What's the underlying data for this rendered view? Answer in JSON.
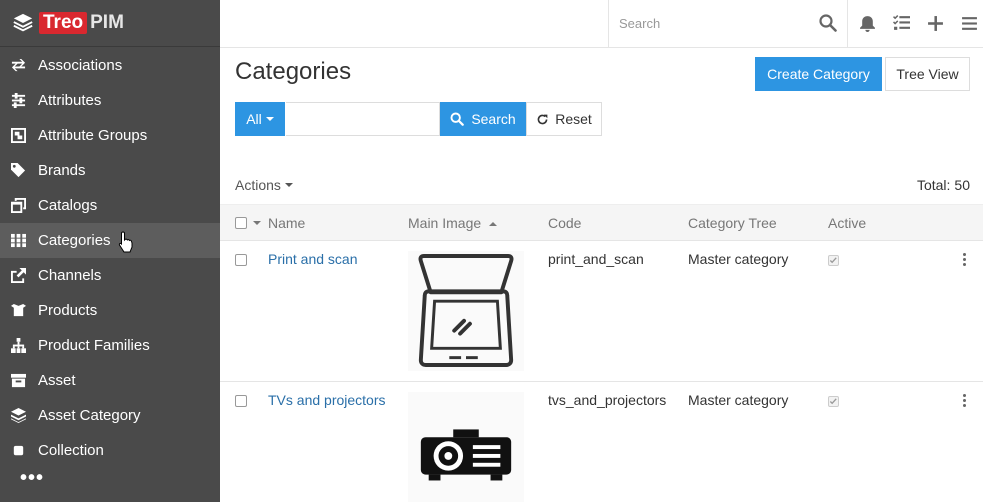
{
  "brand": {
    "treo": "Treo",
    "pim": "PIM",
    "accent": "#d9282f"
  },
  "sidebar": {
    "items": [
      {
        "label": "Associations",
        "icon": "exchange-icon"
      },
      {
        "label": "Attributes",
        "icon": "sliders-icon"
      },
      {
        "label": "Attribute Groups",
        "icon": "object-group-icon"
      },
      {
        "label": "Brands",
        "icon": "tags-icon"
      },
      {
        "label": "Catalogs",
        "icon": "window-restore-icon"
      },
      {
        "label": "Categories",
        "icon": "th-icon",
        "active": true
      },
      {
        "label": "Channels",
        "icon": "share-square-icon"
      },
      {
        "label": "Products",
        "icon": "box-open-icon"
      },
      {
        "label": "Product Families",
        "icon": "sitemap-icon"
      },
      {
        "label": "Asset",
        "icon": "archive-icon"
      },
      {
        "label": "Asset Category",
        "icon": "layer-group-icon"
      },
      {
        "label": "Collection",
        "icon": "square-icon"
      }
    ],
    "more": "•••"
  },
  "topbar": {
    "search_placeholder": "Search"
  },
  "main": {
    "title": "Categories",
    "create_label": "Create Category",
    "tree_label": "Tree View",
    "filter": {
      "all_label": "All",
      "search_label": "Search",
      "reset_label": "Reset",
      "input_value": ""
    },
    "actions_label": "Actions",
    "total_label": "Total:",
    "total_value": "50",
    "columns": [
      "Name",
      "Main Image",
      "Code",
      "Category Tree",
      "Active"
    ],
    "rows": [
      {
        "name": "Print and scan",
        "image": "scanner-icon",
        "code": "print_and_scan",
        "tree": "Master category",
        "active": true
      },
      {
        "name": "TVs and projectors",
        "image": "projector-icon",
        "code": "tvs_and_projectors",
        "tree": "Master category",
        "active": true
      }
    ]
  },
  "colors": {
    "sidebar": "#4a4a4a",
    "primary": "#2d95e2",
    "link": "#2a6fa8"
  }
}
